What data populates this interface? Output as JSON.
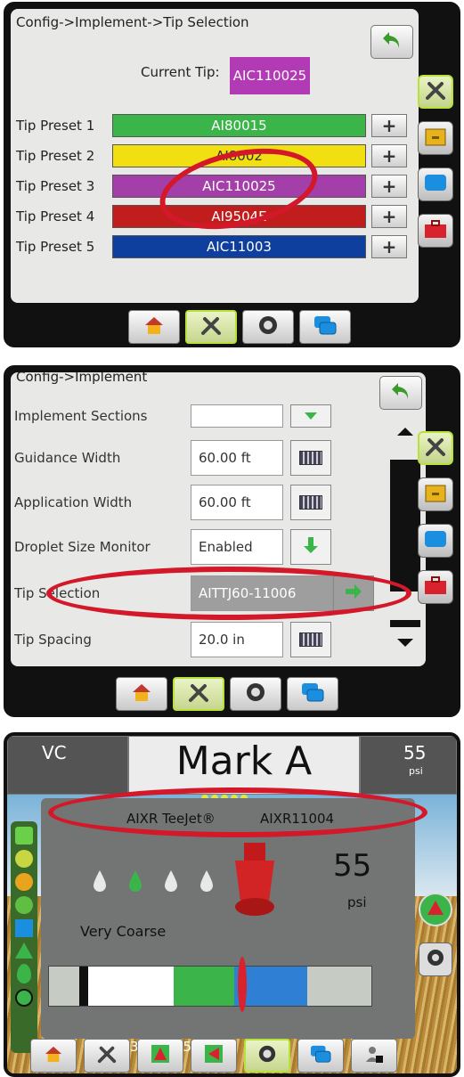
{
  "screen1": {
    "breadcrumb": "Config->Implement->Tip Selection",
    "current_tip_label": "Current Tip:",
    "current_tip_value": "AIC110025",
    "current_tip_color": "#b33ab5",
    "presets": [
      {
        "label": "Tip Preset 1",
        "value": "AI80015",
        "color": "#3bb54a",
        "text_color": "#ffffff"
      },
      {
        "label": "Tip Preset 2",
        "value": "AI8002",
        "color": "#f1df12",
        "text_color": "#333333"
      },
      {
        "label": "Tip Preset 3",
        "value": "AIC110025",
        "color": "#a43ea9",
        "text_color": "#ffffff"
      },
      {
        "label": "Tip Preset 4",
        "value": "AI9504E",
        "color": "#c11d1d",
        "text_color": "#ffffff"
      },
      {
        "label": "Tip Preset 5",
        "value": "AIC11003",
        "color": "#0f3f9e",
        "text_color": "#ffffff"
      }
    ],
    "plus_symbol": "+"
  },
  "screen2": {
    "breadcrumb": "Config->Implement",
    "rows": [
      {
        "label": "Implement Sections",
        "value": "",
        "button": "dropdown"
      },
      {
        "label": "Guidance Width",
        "value": "60.00 ft",
        "button": "keyboard"
      },
      {
        "label": "Application Width",
        "value": "60.00 ft",
        "button": "keyboard"
      },
      {
        "label": "Droplet Size Monitor",
        "value": "Enabled",
        "button": "down-arrow"
      },
      {
        "label": "Tip Selection",
        "value": "AITTJ60-11006",
        "button": "right-arrow"
      },
      {
        "label": "Tip Spacing",
        "value": "20.0 in",
        "button": "keyboard"
      }
    ]
  },
  "screen3": {
    "left_box": "VC",
    "mark": "Mark A",
    "pressure_top": "55",
    "pressure_top_unit": "psi",
    "tip_brand": "AIXR TeeJet®",
    "tip_model": "AIXR11004",
    "pressure_big": "55",
    "pressure_big_unit": "psi",
    "droplet_class": "Very Coarse",
    "scale_ticks": [
      "0",
      "15",
      "30",
      "45",
      "60",
      "75",
      "90"
    ],
    "scale_unit": "psi",
    "needle_value": 60
  },
  "colors": {
    "accent_green": "#3bb54a",
    "highlight_red": "#d3182a",
    "active_outline": "#b8e13a"
  }
}
